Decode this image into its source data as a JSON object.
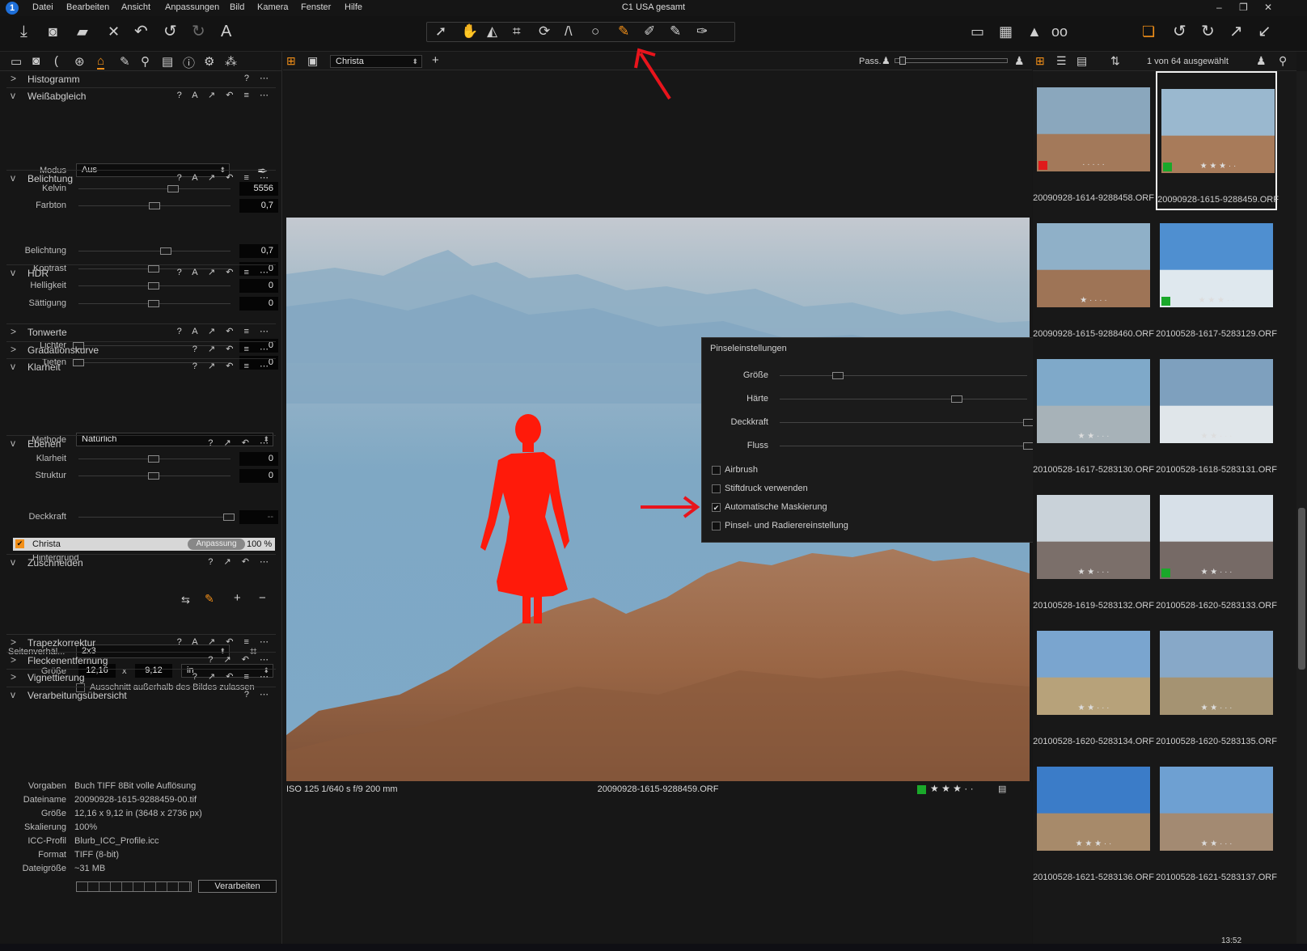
{
  "app": {
    "title": "C1 USA gesamt",
    "menus": [
      "Datei",
      "Bearbeiten",
      "Ansicht",
      "Anpassungen",
      "Bild",
      "Kamera",
      "Fenster",
      "Hilfe"
    ]
  },
  "left_panel": {
    "sections": {
      "histogramm": "Histogramm",
      "weissabgleich": "Weißabgleich",
      "belichtung": "Belichtung",
      "hdr": "HDR",
      "tonwerte": "Tonwerte",
      "gradation": "Gradationskurve",
      "klarheit": "Klarheit",
      "ebenen": "Ebenen",
      "zuschneiden": "Zuschneiden",
      "trapez": "Trapezkorrektur",
      "flecken": "Fleckenentfernung",
      "vignet": "Vignettierung",
      "verarbeitung": "Verarbeitungsübersicht"
    },
    "wb": {
      "modus_label": "Modus",
      "modus_value": "Aus",
      "kelvin_label": "Kelvin",
      "kelvin_value": "5556",
      "farbton_label": "Farbton",
      "farbton_value": "0,7"
    },
    "exposure": {
      "belichtung_label": "Belichtung",
      "belichtung_value": "0,7",
      "kontrast_label": "Kontrast",
      "kontrast_value": "0",
      "helligkeit_label": "Helligkeit",
      "helligkeit_value": "0",
      "saettigung_label": "Sättigung",
      "saettigung_value": "0"
    },
    "hdr": {
      "lichter_label": "Lichter",
      "lichter_value": "0",
      "tiefen_label": "Tiefen",
      "tiefen_value": "0"
    },
    "clarity": {
      "methode_label": "Methode",
      "methode_value": "Natürlich",
      "klarheit_label": "Klarheit",
      "klarheit_value": "0",
      "struktur_label": "Struktur",
      "struktur_value": "0"
    },
    "layers": {
      "deckkraft_label": "Deckkraft",
      "deckkraft_value": "--",
      "layer_name": "Christa",
      "layer_type": "Anpassung",
      "layer_opacity": "100 %",
      "background": "Hintergrund"
    },
    "crop": {
      "ratio_label": "Seitenverhäl...",
      "ratio_value": "2x3",
      "size_label": "Größe",
      "width": "12,16",
      "x": "x",
      "height": "9,12",
      "unit": "in",
      "outside_label": "Ausschnitt außerhalb des Bildes zulassen"
    },
    "process": {
      "rows": [
        {
          "label": "Vorgaben",
          "value": "Buch TIFF 8Bit volle Auflösung"
        },
        {
          "label": "Dateiname",
          "value": "20090928-1615-9288459-00.tif"
        },
        {
          "label": "Größe",
          "value": "12,16 x 9,12 in (3648 x 2736 px)"
        },
        {
          "label": "Skalierung",
          "value": "100%"
        },
        {
          "label": "ICC-Profil",
          "value": "Blurb_ICC_Profile.icc"
        },
        {
          "label": "Format",
          "value": "TIFF (8-bit)"
        },
        {
          "label": "Dateigröße",
          "value": "~31 MB"
        }
      ],
      "button": "Verarbeiten"
    }
  },
  "viewer": {
    "layer_select": "Christa",
    "pass_label": "Pass.",
    "photo_info": "ISO 125  1/640 s  f/9  200 mm",
    "photo_name": "20090928-1615-9288459.ORF"
  },
  "brush_dialog": {
    "title": "Pinseleinstellungen",
    "size_label": "Größe",
    "size_value": "134",
    "hardness_label": "Härte",
    "hardness_value": "71",
    "opacity_label": "Deckkraft",
    "opacity_value": "100",
    "flow_label": "Fluss",
    "flow_value": "100",
    "airbrush": "Airbrush",
    "pen": "Stiftdruck verwenden",
    "automask": "Automatische Maskierung",
    "eraser": "Pinsel- und Radierereinstellung"
  },
  "browser": {
    "count": "1 von 64 ausgewählt",
    "thumbs": [
      {
        "name": "20090928-1614-9288458.ORF"
      },
      {
        "name": "20090928-1615-9288459.ORF"
      },
      {
        "name": "20090928-1615-9288460.ORF"
      },
      {
        "name": "20100528-1617-5283129.ORF"
      },
      {
        "name": "20100528-1617-5283130.ORF"
      },
      {
        "name": "20100528-1618-5283131.ORF"
      },
      {
        "name": "20100528-1619-5283132.ORF"
      },
      {
        "name": "20100528-1620-5283133.ORF"
      },
      {
        "name": "20100528-1620-5283134.ORF"
      },
      {
        "name": "20100528-1620-5283135.ORF"
      },
      {
        "name": "20100528-1621-5283136.ORF"
      },
      {
        "name": "20100528-1621-5283137.ORF"
      }
    ]
  },
  "taskbar": {
    "clock": "13:52"
  },
  "colors": {
    "accent": "#f39019",
    "annotation": "#e8141c",
    "mask": "#ff1a0a",
    "label_green": "#1aa82a",
    "label_red": "#e01b1b"
  }
}
